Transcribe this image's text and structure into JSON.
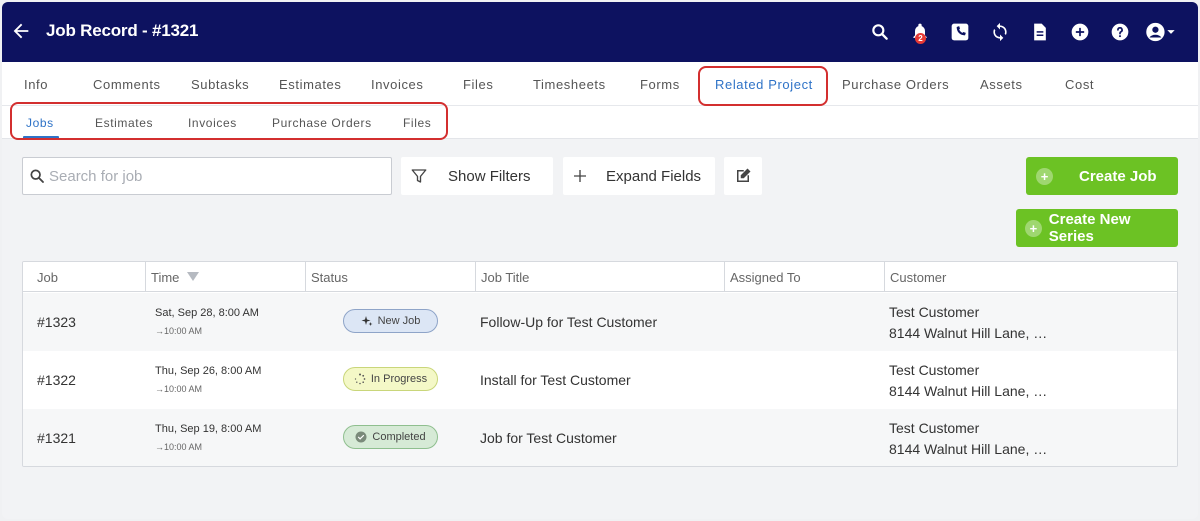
{
  "header": {
    "title": "Job Record - #1321",
    "notification_count": "2",
    "background_color": "#0d1260"
  },
  "main_tabs": [
    {
      "label": "Info"
    },
    {
      "label": "Comments"
    },
    {
      "label": "Subtasks"
    },
    {
      "label": "Estimates"
    },
    {
      "label": "Invoices"
    },
    {
      "label": "Files"
    },
    {
      "label": "Timesheets"
    },
    {
      "label": "Forms"
    },
    {
      "label": "Related Project"
    },
    {
      "label": "Purchase Orders"
    },
    {
      "label": "Assets"
    },
    {
      "label": "Cost"
    }
  ],
  "active_main_tab": "Related Project",
  "sub_tabs": [
    {
      "label": "Jobs"
    },
    {
      "label": "Estimates"
    },
    {
      "label": "Invoices"
    },
    {
      "label": "Purchase Orders"
    },
    {
      "label": "Files"
    }
  ],
  "active_sub_tab": "Jobs",
  "toolbar": {
    "search_placeholder": "Search for job",
    "show_filters": "Show Filters",
    "expand_fields": "Expand Fields",
    "create_job": "Create Job",
    "create_series": "Create New Series",
    "accent_color": "#6cc224"
  },
  "table": {
    "columns": [
      "Job",
      "Time",
      "Status",
      "Job Title",
      "Assigned To",
      "Customer"
    ],
    "rows": [
      {
        "job": "#1323",
        "time_start": "Sat, Sep 28, 8:00 AM",
        "time_end": "→10:00 AM",
        "status": "New Job",
        "status_icon": "sparkle-icon",
        "title": "Follow-Up for Test Customer",
        "assigned": "",
        "customer_name": "Test Customer",
        "customer_address": "8144 Walnut Hill Lane, …"
      },
      {
        "job": "#1322",
        "time_start": "Thu, Sep 26, 8:00 AM",
        "time_end": "→10:00 AM",
        "status": "In Progress",
        "status_icon": "spinner-icon",
        "title": "Install for Test Customer",
        "assigned": "",
        "customer_name": "Test Customer",
        "customer_address": "8144 Walnut Hill Lane, …"
      },
      {
        "job": "#1321",
        "time_start": "Thu, Sep 19, 8:00 AM",
        "time_end": "→10:00 AM",
        "status": "Completed",
        "status_icon": "check-circle-icon",
        "title": "Job for Test Customer",
        "assigned": "",
        "customer_name": "Test Customer",
        "customer_address": "8144 Walnut Hill Lane, …"
      }
    ]
  }
}
